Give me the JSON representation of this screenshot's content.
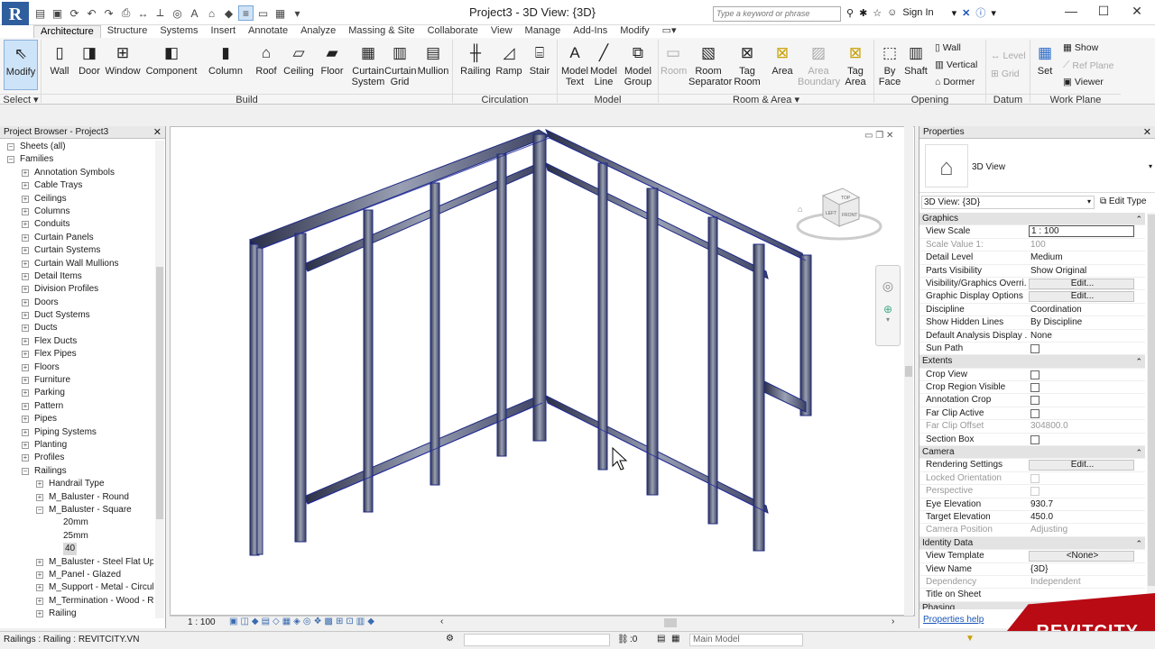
{
  "app": {
    "title": "Project3 - 3D View: {3D}",
    "logo": "R"
  },
  "titlebar": {
    "search_placeholder": "Type a keyword or phrase",
    "sign_in": "Sign In"
  },
  "tabs": [
    "Architecture",
    "Structure",
    "Systems",
    "Insert",
    "Annotate",
    "Analyze",
    "Massing & Site",
    "Collaborate",
    "View",
    "Manage",
    "Add-Ins",
    "Modify"
  ],
  "ribbon": {
    "tools": {
      "modify": "Modify",
      "wall": "Wall",
      "door": "Door",
      "window": "Window",
      "component": "Component",
      "column": "Column",
      "roof": "Roof",
      "ceiling": "Ceiling",
      "floor": "Floor",
      "curtain_system": "Curtain\nSystem",
      "curtain_grid": "Curtain\nGrid",
      "mullion": "Mullion",
      "railing": "Railing",
      "ramp": "Ramp",
      "stair": "Stair",
      "model_text": "Model\nText",
      "model_line": "Model\nLine",
      "model_group": "Model\nGroup",
      "room": "Room",
      "room_separator": "Room\nSeparator",
      "tag_room": "Tag\nRoom",
      "area": "Area",
      "area_boundary": "Area\nBoundary",
      "tag_area": "Tag\nArea",
      "by_face": "By\nFace",
      "shaft": "Shaft",
      "set": "Set"
    },
    "small": {
      "wall": "Wall",
      "vertical": "Vertical",
      "dormer": "Dormer",
      "level": "Level",
      "grid": "Grid",
      "show": "Show",
      "ref_plane": "Ref Plane",
      "viewer": "Viewer"
    },
    "panels": {
      "select": "Select",
      "build": "Build",
      "circulation": "Circulation",
      "model": "Model",
      "room_area": "Room & Area",
      "opening": "Opening",
      "datum": "Datum",
      "work_plane": "Work Plane"
    }
  },
  "browser": {
    "title": "Project Browser - Project3",
    "items": [
      {
        "label": "Sheets (all)",
        "level": 0,
        "exp": "-"
      },
      {
        "label": "Families",
        "level": 0,
        "exp": "-"
      },
      {
        "label": "Annotation Symbols",
        "level": 1,
        "exp": "+"
      },
      {
        "label": "Cable Trays",
        "level": 1,
        "exp": "+"
      },
      {
        "label": "Ceilings",
        "level": 1,
        "exp": "+"
      },
      {
        "label": "Columns",
        "level": 1,
        "exp": "+"
      },
      {
        "label": "Conduits",
        "level": 1,
        "exp": "+"
      },
      {
        "label": "Curtain Panels",
        "level": 1,
        "exp": "+"
      },
      {
        "label": "Curtain Systems",
        "level": 1,
        "exp": "+"
      },
      {
        "label": "Curtain Wall Mullions",
        "level": 1,
        "exp": "+"
      },
      {
        "label": "Detail Items",
        "level": 1,
        "exp": "+"
      },
      {
        "label": "Division Profiles",
        "level": 1,
        "exp": "+"
      },
      {
        "label": "Doors",
        "level": 1,
        "exp": "+"
      },
      {
        "label": "Duct Systems",
        "level": 1,
        "exp": "+"
      },
      {
        "label": "Ducts",
        "level": 1,
        "exp": "+"
      },
      {
        "label": "Flex Ducts",
        "level": 1,
        "exp": "+"
      },
      {
        "label": "Flex Pipes",
        "level": 1,
        "exp": "+"
      },
      {
        "label": "Floors",
        "level": 1,
        "exp": "+"
      },
      {
        "label": "Furniture",
        "level": 1,
        "exp": "+"
      },
      {
        "label": "Parking",
        "level": 1,
        "exp": "+"
      },
      {
        "label": "Pattern",
        "level": 1,
        "exp": "+"
      },
      {
        "label": "Pipes",
        "level": 1,
        "exp": "+"
      },
      {
        "label": "Piping Systems",
        "level": 1,
        "exp": "+"
      },
      {
        "label": "Planting",
        "level": 1,
        "exp": "+"
      },
      {
        "label": "Profiles",
        "level": 1,
        "exp": "+"
      },
      {
        "label": "Railings",
        "level": 1,
        "exp": "-"
      },
      {
        "label": "Handrail Type",
        "level": 2,
        "exp": "+"
      },
      {
        "label": "M_Baluster - Round",
        "level": 2,
        "exp": "+"
      },
      {
        "label": "M_Baluster - Square",
        "level": 2,
        "exp": "-"
      },
      {
        "label": "20mm",
        "level": 3,
        "exp": ""
      },
      {
        "label": "25mm",
        "level": 3,
        "exp": ""
      },
      {
        "label": "40",
        "level": 3,
        "exp": "",
        "sel": true
      },
      {
        "label": "M_Baluster - Steel Flat Upric",
        "level": 2,
        "exp": "+"
      },
      {
        "label": "M_Panel - Glazed",
        "level": 2,
        "exp": "+"
      },
      {
        "label": "M_Support - Metal - Circula",
        "level": 2,
        "exp": "+"
      },
      {
        "label": "M_Termination - Wood - Re",
        "level": 2,
        "exp": "+"
      },
      {
        "label": "Railing",
        "level": 2,
        "exp": "+"
      }
    ]
  },
  "viewcube": {
    "top": "TOP",
    "left": "LEFT",
    "front": "FRONT"
  },
  "view_status": {
    "scale": "1 : 100"
  },
  "properties": {
    "title": "Properties",
    "type_name": "3D View",
    "selector": "3D View: {3D}",
    "edit_type": "Edit Type",
    "rows": [
      {
        "cat": "Graphics"
      },
      {
        "k": "View Scale",
        "v": "1 : 100",
        "t": "input"
      },
      {
        "k": "Scale Value    1:",
        "v": "100",
        "dis": true
      },
      {
        "k": "Detail Level",
        "v": "Medium"
      },
      {
        "k": "Parts Visibility",
        "v": "Show Original"
      },
      {
        "k": "Visibility/Graphics Overri...",
        "v": "Edit...",
        "t": "btn"
      },
      {
        "k": "Graphic Display Options",
        "v": "Edit...",
        "t": "btn"
      },
      {
        "k": "Discipline",
        "v": "Coordination"
      },
      {
        "k": "Show Hidden Lines",
        "v": "By Discipline"
      },
      {
        "k": "Default Analysis Display ...",
        "v": "None"
      },
      {
        "k": "Sun Path",
        "t": "cb"
      },
      {
        "cat": "Extents"
      },
      {
        "k": "Crop View",
        "t": "cb"
      },
      {
        "k": "Crop Region Visible",
        "t": "cb"
      },
      {
        "k": "Annotation Crop",
        "t": "cb"
      },
      {
        "k": "Far Clip Active",
        "t": "cb"
      },
      {
        "k": "Far Clip Offset",
        "v": "304800.0",
        "dis": true
      },
      {
        "k": "Section Box",
        "t": "cb"
      },
      {
        "cat": "Camera"
      },
      {
        "k": "Rendering Settings",
        "v": "Edit...",
        "t": "btn"
      },
      {
        "k": "Locked Orientation",
        "t": "cb",
        "dis": true
      },
      {
        "k": "Perspective",
        "t": "cb",
        "dis": true
      },
      {
        "k": "Eye Elevation",
        "v": "930.7"
      },
      {
        "k": "Target Elevation",
        "v": "450.0"
      },
      {
        "k": "Camera Position",
        "v": "Adjusting",
        "dis": true
      },
      {
        "cat": "Identity Data"
      },
      {
        "k": "View Template",
        "v": "<None>",
        "t": "btn"
      },
      {
        "k": "View Name",
        "v": "{3D}"
      },
      {
        "k": "Dependency",
        "v": "Independent",
        "dis": true
      },
      {
        "k": "Title on Sheet",
        "v": ""
      },
      {
        "cat": "Phasing"
      }
    ],
    "help": "Properties help"
  },
  "status": {
    "text": "Railings : Railing : REVITCITY.VN",
    "zero": ":0",
    "model": "Main Model"
  },
  "watermark": "REVITCITY"
}
